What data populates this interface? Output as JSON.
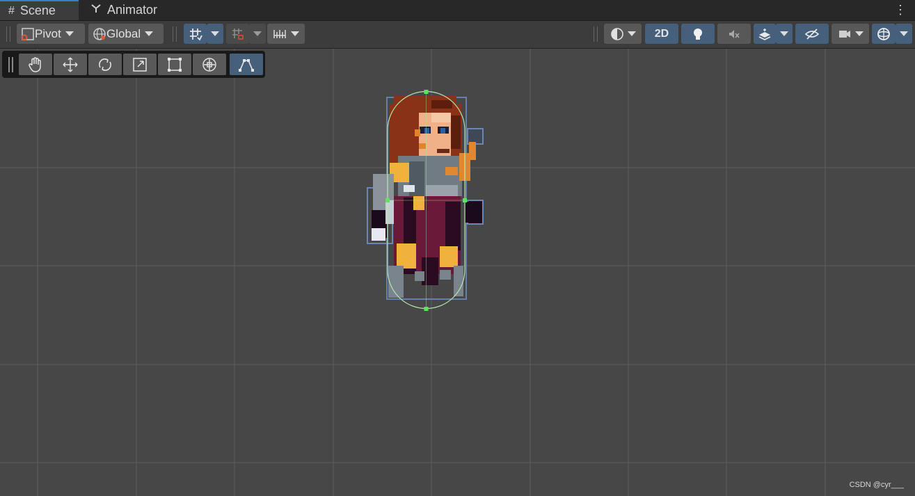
{
  "tabs": [
    {
      "label": "Scene",
      "icon": "hash-icon",
      "active": true
    },
    {
      "label": "Animator",
      "icon": "animator-icon",
      "active": false
    }
  ],
  "toolbar": {
    "pivot_label": "Pivot",
    "global_label": "Global",
    "mode_2d_label": "2D",
    "icons": [
      "grid-snap-icon",
      "increment-snap-icon",
      "ruler-icon",
      "draw-mode-icon",
      "lighting-icon",
      "audio-mute-icon",
      "effects-icon",
      "visibility-icon",
      "camera-icon",
      "gizmos-icon"
    ]
  },
  "tools": [
    "hand-tool",
    "move-tool",
    "rotate-tool",
    "scale-tool",
    "rect-tool",
    "transform-tool",
    "custom-editor-tool"
  ],
  "active_tool": "custom-editor-tool",
  "colors": {
    "background": "#474747",
    "toolbar": "#3c3c3c",
    "accent_blue": "#46607c",
    "collider": "#b7e8ae",
    "handle": "#5ee35e",
    "hair": "#8a3218",
    "skin": "#f0b088",
    "armor": "#707b84",
    "dress": "#6b1938",
    "gold": "#f0b23c"
  },
  "watermark": "CSDN @cyr___"
}
